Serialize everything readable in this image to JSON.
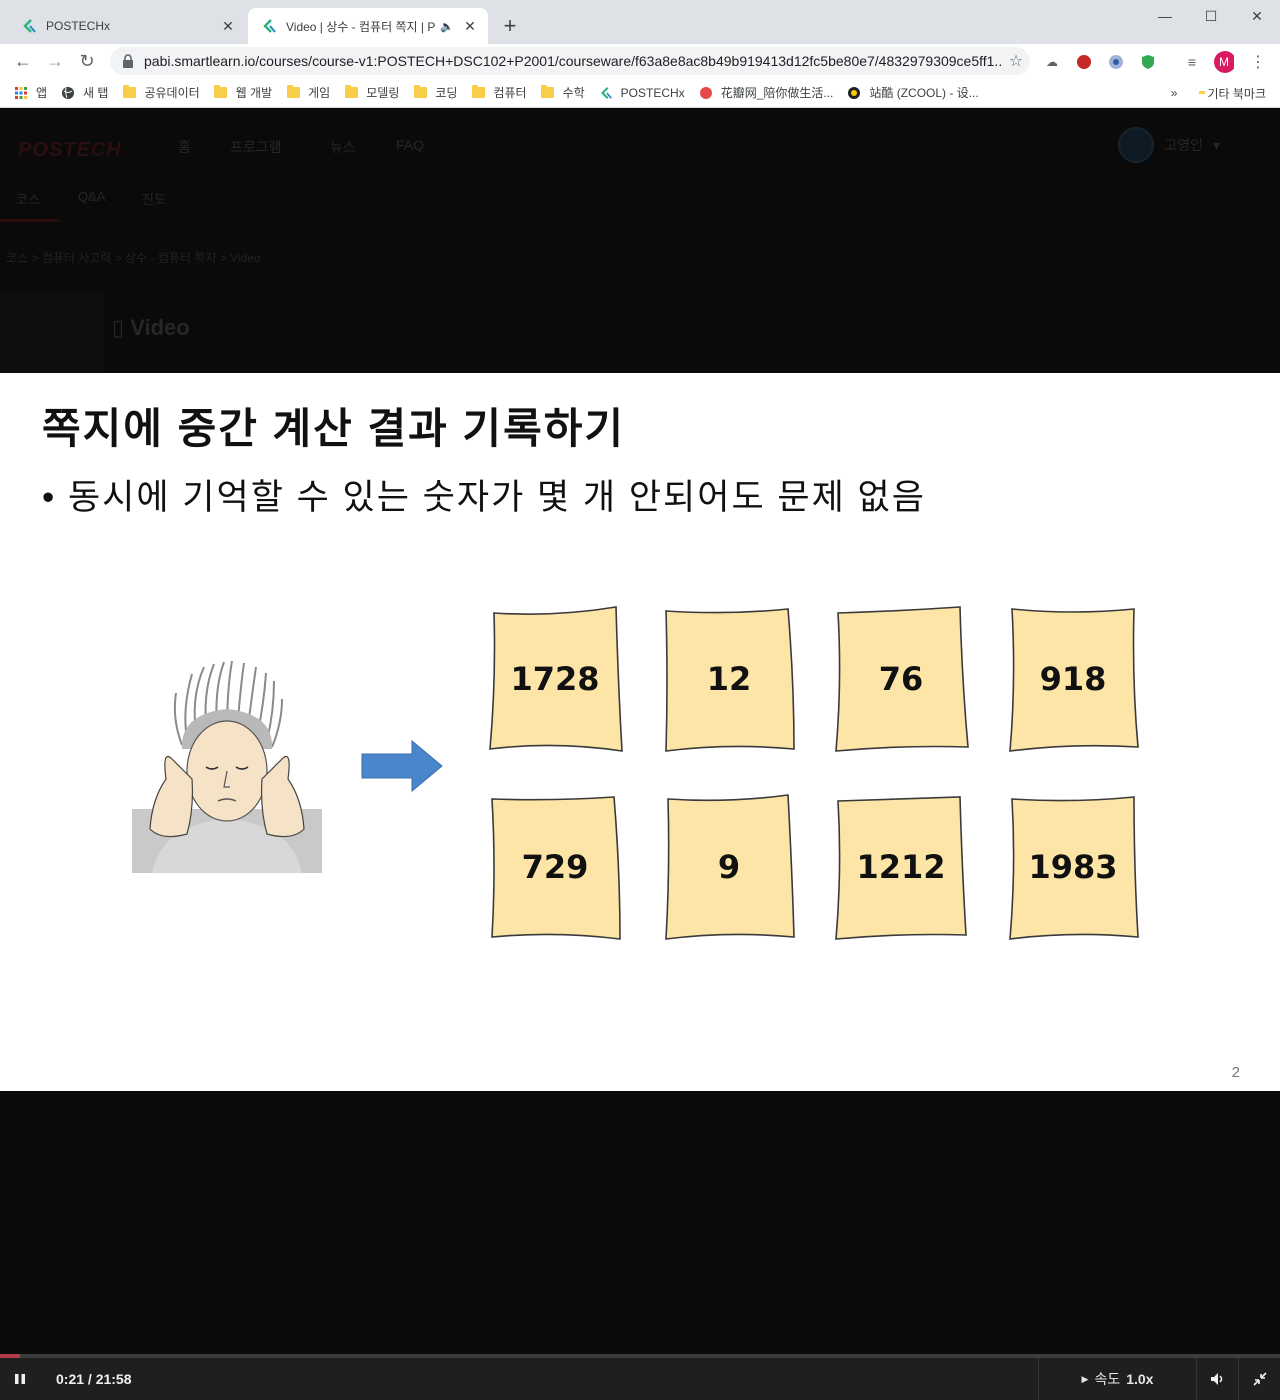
{
  "browser": {
    "tabs": [
      {
        "title": "POSTECHx",
        "active": false
      },
      {
        "title": "Video | 상수 - 컴퓨터 쪽지 | P",
        "active": true
      }
    ],
    "url": "pabi.smartlearn.io/courses/course-v1:POSTECH+DSC102+P2001/courseware/f63a8e8ac8b49b919413d12fc5be80e7/4832979309ce5ff1...",
    "profile_initial": "M",
    "bookmarks": [
      "앱",
      "새 탭",
      "공유데이터",
      "웹 개발",
      "게임",
      "모델링",
      "코딩",
      "컴퓨터",
      "수학",
      "POSTECHx",
      "花瓣网_陪你做生活...",
      "站酷 (ZCOOL) - 设..."
    ],
    "bookmarks_overflow": "»",
    "other_bookmarks": "기타 북마크"
  },
  "page": {
    "logo": "POSTECH",
    "topnav": [
      "홈",
      "프로그램",
      "뉴스",
      "FAQ"
    ],
    "user_name": "고영인",
    "subnav": [
      "코스",
      "Q&A",
      "진도"
    ],
    "breadcrumb": "코스 > 컴퓨터 사고력 > 상수 - 컴퓨터 쪽지 > Video",
    "video_heading": "Video"
  },
  "slide": {
    "title": "쪽지에 중간 계산 결과 기록하기",
    "bullet": "• 동시에 기억할 수 있는 숫자가 몇 개 안되어도 문제 없음",
    "notes": [
      "1728",
      "12",
      "76",
      "918",
      "729",
      "9",
      "1212",
      "1983"
    ],
    "page_number": "2"
  },
  "player": {
    "time": "0:21 / 21:58",
    "progress_fraction": 0.016,
    "speed_label": "속도",
    "speed_value": "1.0x"
  },
  "colors": {
    "note_fill": "#fde5a8",
    "arrow": "#4a86cc",
    "progress": "#b03a4a"
  }
}
